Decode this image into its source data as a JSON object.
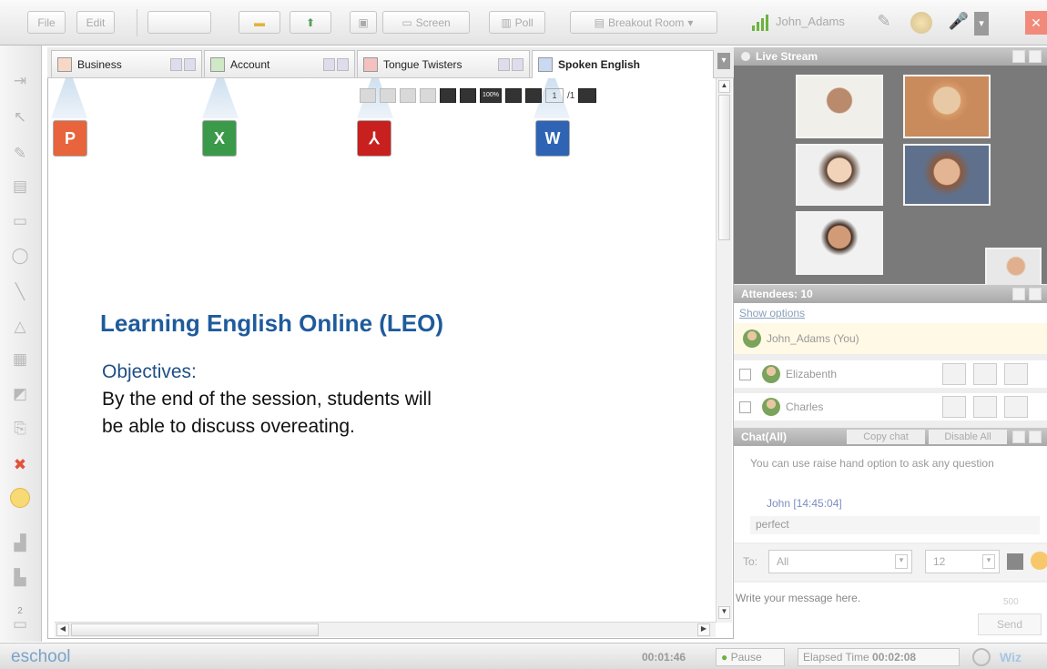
{
  "toolbar": {
    "file": "File",
    "edit": "Edit",
    "screen": "Screen",
    "poll": "Poll",
    "breakout": "Breakout Room",
    "user": "John_Adams"
  },
  "tabs": [
    {
      "label": "Business",
      "type": "ppt"
    },
    {
      "label": "Account",
      "type": "xls"
    },
    {
      "label": "Tongue Twisters",
      "type": "pdf"
    },
    {
      "label": "Spoken English",
      "type": "doc"
    }
  ],
  "doc_toolbar": {
    "zoom": "100%",
    "page": "1",
    "pages": "/1"
  },
  "slide": {
    "title": "Learning English Online (LEO)",
    "objectives_label": "Objectives:",
    "line1": "By the end of the session, students will",
    "line2": "be able to discuss overeating."
  },
  "live_stream": {
    "title": "Live Stream"
  },
  "attendees": {
    "title": "Attendees: 10",
    "show_options": "Show options",
    "me": "John_Adams (You)",
    "list": [
      {
        "name": "Elizabenth"
      },
      {
        "name": "Charles"
      }
    ]
  },
  "chat": {
    "title": "Chat(All)",
    "copy": "Copy chat",
    "disable": "Disable All",
    "msg1": "You can use raise hand option to ask any question",
    "sender": "John [14:45:04]",
    "msg2": "perfect",
    "to_label": "To:",
    "to_value": "All",
    "font_size": "12",
    "placeholder": "Write your message here.",
    "char_count": "500",
    "send": "Send"
  },
  "status": {
    "brand": "eschool",
    "clock": "00:01:46",
    "pause": "Pause",
    "elapsed_label": "Elapsed Time",
    "elapsed": "00:02:08",
    "wiz": "Wiz"
  },
  "colors": {
    "title_blue": "#1f5b9c",
    "brand": "#7aa3c9"
  }
}
